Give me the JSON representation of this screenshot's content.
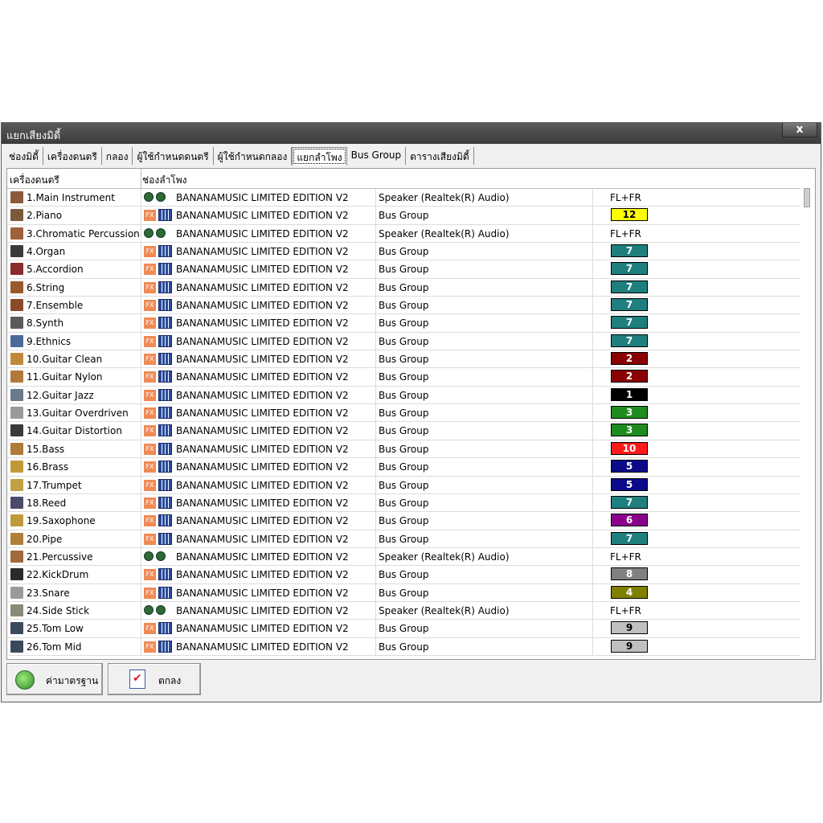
{
  "window": {
    "title": "แยกเสียงมิดี้",
    "close_label": "x"
  },
  "tabs": [
    {
      "label": "ช่องมิดี้",
      "active": false
    },
    {
      "label": "เครื่องดนตรี",
      "active": false
    },
    {
      "label": "กลอง",
      "active": false
    },
    {
      "label": "ผู้ใช้กำหนดดนตรี",
      "active": false
    },
    {
      "label": "ผู้ใช้กำหนดกลอง",
      "active": false
    },
    {
      "label": "แยกลำโพง",
      "active": true
    },
    {
      "label": "Bus Group",
      "active": false
    },
    {
      "label": "ตารางเสียงมิดี้",
      "active": false
    }
  ],
  "table": {
    "headers": [
      "เครื่องดนตรี",
      "ช่องลำโพง"
    ],
    "rows": [
      {
        "name": "1.Main Instrument",
        "mode": "speaker",
        "device": "BANANAMUSIC LIMITED EDITION V2",
        "output": "Speaker (Realtek(R) Audio)",
        "channel": "FL+FR",
        "icon_color": "#8a5a3a"
      },
      {
        "name": "2.Piano",
        "mode": "bus",
        "device": "BANANAMUSIC LIMITED EDITION V2",
        "output": "Bus Group",
        "channel": "12",
        "badge_color": "#ffff00",
        "badge_text_color": "#000000",
        "icon_color": "#7a5a3a"
      },
      {
        "name": "3.Chromatic Percussion",
        "mode": "speaker",
        "device": "BANANAMUSIC LIMITED EDITION V2",
        "output": "Speaker (Realtek(R) Audio)",
        "channel": "FL+FR",
        "icon_color": "#a0603a"
      },
      {
        "name": "4.Organ",
        "mode": "bus",
        "device": "BANANAMUSIC LIMITED EDITION V2",
        "output": "Bus Group",
        "channel": "7",
        "badge_color": "#1f7f7f",
        "badge_text_color": "#ffffff",
        "icon_color": "#3a3a3a"
      },
      {
        "name": "5.Accordion",
        "mode": "bus",
        "device": "BANANAMUSIC LIMITED EDITION V2",
        "output": "Bus Group",
        "channel": "7",
        "badge_color": "#1f7f7f",
        "badge_text_color": "#ffffff",
        "icon_color": "#8a2a2a"
      },
      {
        "name": "6.String",
        "mode": "bus",
        "device": "BANANAMUSIC LIMITED EDITION V2",
        "output": "Bus Group",
        "channel": "7",
        "badge_color": "#1f7f7f",
        "badge_text_color": "#ffffff",
        "icon_color": "#9a5a2a"
      },
      {
        "name": "7.Ensemble",
        "mode": "bus",
        "device": "BANANAMUSIC LIMITED EDITION V2",
        "output": "Bus Group",
        "channel": "7",
        "badge_color": "#1f7f7f",
        "badge_text_color": "#ffffff",
        "icon_color": "#8a4a2a"
      },
      {
        "name": "8.Synth",
        "mode": "bus",
        "device": "BANANAMUSIC LIMITED EDITION V2",
        "output": "Bus Group",
        "channel": "7",
        "badge_color": "#1f7f7f",
        "badge_text_color": "#ffffff",
        "icon_color": "#5a5a5a"
      },
      {
        "name": "9.Ethnics",
        "mode": "bus",
        "device": "BANANAMUSIC LIMITED EDITION V2",
        "output": "Bus Group",
        "channel": "7",
        "badge_color": "#1f7f7f",
        "badge_text_color": "#ffffff",
        "icon_color": "#4a6a9a"
      },
      {
        "name": "10.Guitar Clean",
        "mode": "bus",
        "device": "BANANAMUSIC LIMITED EDITION V2",
        "output": "Bus Group",
        "channel": "2",
        "badge_color": "#8b0000",
        "badge_text_color": "#ffffff",
        "icon_color": "#c08a3a"
      },
      {
        "name": "11.Guitar Nylon",
        "mode": "bus",
        "device": "BANANAMUSIC LIMITED EDITION V2",
        "output": "Bus Group",
        "channel": "2",
        "badge_color": "#8b0000",
        "badge_text_color": "#ffffff",
        "icon_color": "#b07a3a"
      },
      {
        "name": "12.Guitar Jazz",
        "mode": "bus",
        "device": "BANANAMUSIC LIMITED EDITION V2",
        "output": "Bus Group",
        "channel": "1",
        "badge_color": "#000000",
        "badge_text_color": "#ffffff",
        "icon_color": "#6a7a8a"
      },
      {
        "name": "13.Guitar Overdriven",
        "mode": "bus",
        "device": "BANANAMUSIC LIMITED EDITION V2",
        "output": "Bus Group",
        "channel": "3",
        "badge_color": "#1e8c1e",
        "badge_text_color": "#ffffff",
        "icon_color": "#9a9a9a"
      },
      {
        "name": "14.Guitar Distortion",
        "mode": "bus",
        "device": "BANANAMUSIC LIMITED EDITION V2",
        "output": "Bus Group",
        "channel": "3",
        "badge_color": "#1e8c1e",
        "badge_text_color": "#ffffff",
        "icon_color": "#3a3a3a"
      },
      {
        "name": "15.Bass",
        "mode": "bus",
        "device": "BANANAMUSIC LIMITED EDITION V2",
        "output": "Bus Group",
        "channel": "10",
        "badge_color": "#ff1a1a",
        "badge_text_color": "#ffffff",
        "icon_color": "#b07a3a"
      },
      {
        "name": "16.Brass",
        "mode": "bus",
        "device": "BANANAMUSIC LIMITED EDITION V2",
        "output": "Bus Group",
        "channel": "5",
        "badge_color": "#0a0a8a",
        "badge_text_color": "#ffffff",
        "icon_color": "#c09a3a"
      },
      {
        "name": "17.Trumpet",
        "mode": "bus",
        "device": "BANANAMUSIC LIMITED EDITION V2",
        "output": "Bus Group",
        "channel": "5",
        "badge_color": "#0a0a8a",
        "badge_text_color": "#ffffff",
        "icon_color": "#c0a040"
      },
      {
        "name": "18.Reed",
        "mode": "bus",
        "device": "BANANAMUSIC LIMITED EDITION V2",
        "output": "Bus Group",
        "channel": "7",
        "badge_color": "#1f7f7f",
        "badge_text_color": "#ffffff",
        "icon_color": "#4a4a6a"
      },
      {
        "name": "19.Saxophone",
        "mode": "bus",
        "device": "BANANAMUSIC LIMITED EDITION V2",
        "output": "Bus Group",
        "channel": "6",
        "badge_color": "#8b008b",
        "badge_text_color": "#ffffff",
        "icon_color": "#c09a3a"
      },
      {
        "name": "20.Pipe",
        "mode": "bus",
        "device": "BANANAMUSIC LIMITED EDITION V2",
        "output": "Bus Group",
        "channel": "7",
        "badge_color": "#1f7f7f",
        "badge_text_color": "#ffffff",
        "icon_color": "#b0803a"
      },
      {
        "name": "21.Percussive",
        "mode": "speaker",
        "device": "BANANAMUSIC LIMITED EDITION V2",
        "output": "Speaker (Realtek(R) Audio)",
        "channel": "FL+FR",
        "icon_color": "#a06a3a"
      },
      {
        "name": "22.KickDrum",
        "mode": "bus",
        "device": "BANANAMUSIC LIMITED EDITION V2",
        "output": "Bus Group",
        "channel": "8",
        "badge_color": "#808080",
        "badge_text_color": "#ffffff",
        "icon_color": "#2a2a2a"
      },
      {
        "name": "23.Snare",
        "mode": "bus",
        "device": "BANANAMUSIC LIMITED EDITION V2",
        "output": "Bus Group",
        "channel": "4",
        "badge_color": "#808000",
        "badge_text_color": "#ffffff",
        "icon_color": "#9a9a9a"
      },
      {
        "name": "24.Side Stick",
        "mode": "speaker",
        "device": "BANANAMUSIC LIMITED EDITION V2",
        "output": "Speaker (Realtek(R) Audio)",
        "channel": "FL+FR",
        "icon_color": "#8a8a7a"
      },
      {
        "name": "25.Tom Low",
        "mode": "bus",
        "device": "BANANAMUSIC LIMITED EDITION V2",
        "output": "Bus Group",
        "channel": "9",
        "badge_color": "#c0c0c0",
        "badge_text_color": "#000000",
        "icon_color": "#3a4a5a"
      },
      {
        "name": "26.Tom Mid",
        "mode": "bus",
        "device": "BANANAMUSIC LIMITED EDITION V2",
        "output": "Bus Group",
        "channel": "9",
        "badge_color": "#c0c0c0",
        "badge_text_color": "#000000",
        "icon_color": "#3a4a5a"
      }
    ]
  },
  "buttons": {
    "default_label": "ค่ามาตรฐาน",
    "ok_label": "ตกลง"
  },
  "icons": {
    "speaker_mode": "green-dots-icon",
    "bus_mode": "fx-mixer-icon"
  }
}
